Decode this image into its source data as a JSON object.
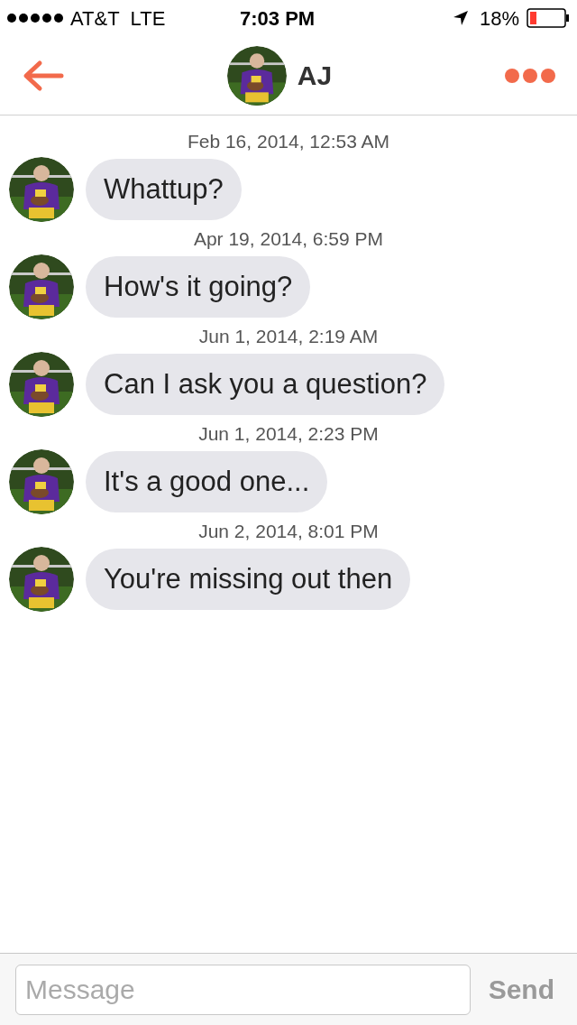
{
  "status_bar": {
    "carrier": "AT&T",
    "network": "LTE",
    "time": "7:03 PM",
    "battery": "18%"
  },
  "header": {
    "name": "AJ"
  },
  "messages": [
    {
      "timestamp": "Feb 16, 2014, 12:53 AM",
      "text": "Whattup?"
    },
    {
      "timestamp": "Apr 19, 2014, 6:59 PM",
      "text": "How's it going?"
    },
    {
      "timestamp": "Jun 1, 2014, 2:19 AM",
      "text": "Can I ask you a question?"
    },
    {
      "timestamp": "Jun 1, 2014, 2:23 PM",
      "text": "It's a good one..."
    },
    {
      "timestamp": "Jun 2, 2014, 8:01 PM",
      "text": "You're missing out then"
    }
  ],
  "composer": {
    "placeholder": "Message",
    "send": {
      "label": "Send",
      "disabled": true
    }
  }
}
